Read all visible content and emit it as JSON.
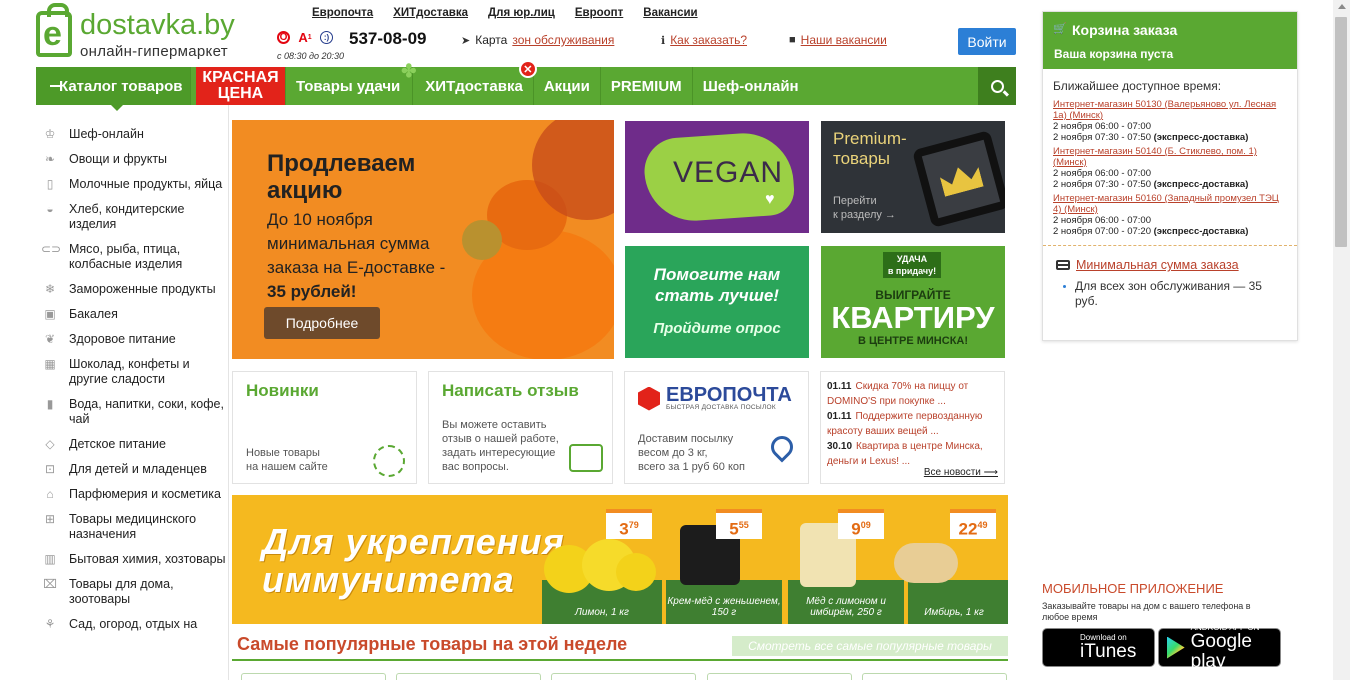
{
  "header": {
    "logo_name": "dostavka.by",
    "logo_letter": "e",
    "logo_sub": "онлайн-гипермаркет",
    "top_links": [
      "Европочта",
      "ХИТдоставка",
      "Для юр.лиц",
      "Евроопт",
      "Вакансии"
    ],
    "phone": "537-08-09",
    "hours": "с 08:30 до 20:30",
    "map_text": "Карта",
    "map_link": "зон обслуживания",
    "how_to_order": "Как заказать?",
    "vacancies": "Наши вакансии",
    "login": "Войти"
  },
  "nav": {
    "catalog": "Каталог товаров",
    "red_price_line1": "Красная",
    "red_price_line2": "цена",
    "items": [
      "Товары удачи",
      "ХИТдоставка",
      "Акции",
      "PREMIUM",
      "Шеф-онлайн"
    ]
  },
  "categories": [
    "Шеф-онлайн",
    "Овощи и фрукты",
    "Молочные продукты, яйца",
    "Хлеб, кондитерские изделия",
    "Мясо, рыба, птица, колбасные изделия",
    "Замороженные продукты",
    "Бакалея",
    "Здоровое питание",
    "Шоколад, конфеты и другие сладости",
    "Вода, напитки, соки, кофе, чай",
    "Детское питание",
    "Для детей и младенцев",
    "Парфюмерия и косметика",
    "Товары медицинского назначения",
    "Бытовая химия, хозтовары",
    "Товары для дома, зоотовары",
    "Сад, огород, отдых на"
  ],
  "banners": {
    "main_title_1": "Продлеваем",
    "main_title_2": "акцию",
    "main_sub_1": "До 10 ноября",
    "main_sub_2": "минимальная сумма",
    "main_sub_3": "заказа на Е-доставке -",
    "main_sub_4": "35 рублей!",
    "main_button": "Подробнее",
    "vegan": "VEGAN",
    "premium_1": "Premium-",
    "premium_2": "товары",
    "premium_link_1": "Перейти",
    "premium_link_2": "к разделу →",
    "survey_1": "Помогите нам",
    "survey_2": "стать лучше!",
    "survey_3": "Пройдите опрос",
    "lucky_badge_1": "УДАЧА",
    "lucky_badge_2": "в придачу!",
    "lucky_1": "ВЫИГРАЙТЕ",
    "lucky_2": "КВАРТИРУ",
    "lucky_3": "В ЦЕНТРЕ МИНСКА!"
  },
  "cards": {
    "new_title": "Новинки",
    "new_desc_1": "Новые товары",
    "new_desc_2": "на нашем сайте",
    "review_title": "Написать отзыв",
    "review_desc_1": "Вы можете оставить",
    "review_desc_2": "отзыв о нашей работе,",
    "review_desc_3": "задать интересующие",
    "review_desc_4": "вас вопросы.",
    "ep_name": "ЕВРОПОЧТА",
    "ep_sub": "БЫСТРАЯ ДОСТАВКА ПОСЫЛОК",
    "ep_desc_1": "Доставим посылку",
    "ep_desc_2": "весом до 3 кг,",
    "ep_desc_3": "всего за 1 руб 60 коп",
    "news": [
      {
        "date": "01.11",
        "text": "Скидка 70% на пиццу от DOMINO'S при покупке ..."
      },
      {
        "date": "01.11",
        "text": "Поддержите первозданную красоту ваших вещей ..."
      },
      {
        "date": "30.10",
        "text": "Квартира в центре Минска, деньги и Lexus! ..."
      }
    ],
    "all_news": "Все новости ⟶"
  },
  "immunity": {
    "title_1": "Для укрепления",
    "title_2": "иммунитета",
    "products": [
      {
        "price": "3",
        "cents": "79",
        "name": "Лимон, 1 кг"
      },
      {
        "price": "5",
        "cents": "55",
        "name": "Крем-мёд с женьшенем, 150 г"
      },
      {
        "price": "9",
        "cents": "09",
        "name": "Мёд с лимоном и имбирём, 250 г"
      },
      {
        "price": "22",
        "cents": "49",
        "name": "Имбирь, 1 кг"
      }
    ]
  },
  "popular": {
    "title": "Самые популярные товары на этой неделе",
    "link": "Смотреть все самые популярные товары"
  },
  "cart": {
    "title": "Корзина заказа",
    "empty": "Ваша корзина пуста",
    "nearest": "Ближайшее доступное время:",
    "stores": [
      {
        "name": "Интернет-магазин 50130 (Валерьяново ул. Лесная 1а) (Минск)",
        "t1": "2 ноября 06:00 - 07:00",
        "t2": "2 ноября 07:30 - 07:50",
        "express": "(экспресс-доставка)"
      },
      {
        "name": "Интернет-магазин 50140 (Б. Стиклево, пом. 1) (Минск)",
        "t1": "2 ноября 06:00 - 07:00",
        "t2": "2 ноября 07:30 - 07:50",
        "express": "(экспресс-доставка)"
      },
      {
        "name": "Интернет-магазин 50160 (Западный промузел ТЭЦ 4) (Минск)",
        "t1": "2 ноября 06:00 - 07:00",
        "t2": "2 ноября 07:00 - 07:20",
        "express": "(экспресс-доставка)"
      }
    ],
    "min_sum_title": "Минимальная сумма заказа",
    "min_sum_text": "Для всех зон обслуживания — 35 руб."
  },
  "mobile": {
    "title": "МОБИЛЬНОЕ ПРИЛОЖЕНИЕ",
    "sub": "Заказывайте товары на дом с вашего телефона в любое время",
    "itunes_small": "Download on",
    "itunes_big": "iTunes",
    "gplay_small": "ANDROID APP ON",
    "gplay_big": "Google play"
  },
  "colors": {
    "brand_green": "#5aa832",
    "accent_red": "#e2231a",
    "link_red": "#b9412b",
    "login_blue": "#2c7fd6"
  }
}
